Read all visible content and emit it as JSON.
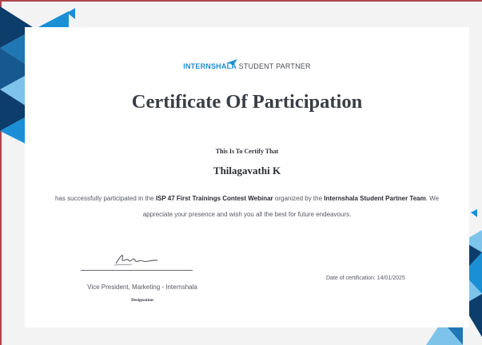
{
  "brand": {
    "name_part1": "INTERN",
    "name_part2": "SHALA",
    "suffix": " STUDENT PARTNER"
  },
  "certificate": {
    "title": "Certificate Of Participation",
    "certify_line": "This Is To Certify That",
    "recipient": "Thilagavathi K",
    "body": {
      "part1": "has successfully participated in the ",
      "event": "ISP 47 First Trainings Contest Webinar",
      "part2": " organized by the ",
      "team": "Internshala Student Partner Team",
      "part3": ". We appreciate your presence and wish you all the best for future endeavours."
    },
    "signatory_role": "Vice President, Marketing - Internshala",
    "designation_label": "Designation",
    "date_line": "Date of certification: 14/01/2025"
  },
  "icons": {
    "logo": "paper-plane-icon",
    "signature": "handwritten-signature"
  },
  "colors": {
    "brand_blue": "#1a8fd6",
    "triangle_dark": "#0d3d6b",
    "triangle_mid": "#1f77b4",
    "triangle_light": "#7ec4ea",
    "page_border": "#b0444c"
  }
}
